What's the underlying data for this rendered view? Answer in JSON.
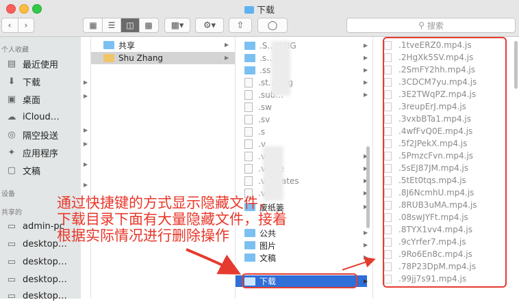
{
  "window": {
    "title": "下载"
  },
  "toolbar": {
    "search_placeholder": "搜索"
  },
  "sidebar": {
    "favorites_header": "个人收藏",
    "favorites": [
      "最近使用",
      "下载",
      "桌面",
      "iCloud…",
      "隔空投送",
      "应用程序",
      "文稿"
    ],
    "devices_header": "设备",
    "shared_header": "共享的",
    "shared": [
      "admin-pc",
      "desktop…",
      "desktop…",
      "desktop…",
      "desktop…"
    ]
  },
  "column2": {
    "items": [
      "共享",
      "Shu Zhang"
    ]
  },
  "column3": {
    "items": [
      ".S…X-NG",
      ".s…put",
      ".ss",
      ".st…Msg",
      ".sub…",
      ".sw",
      ".sv",
      ".s",
      ".v",
      ".v",
      ".v…de",
      ".v…plates",
      ".v…",
      "废纸篓",
      "公共",
      "图片",
      "文稿",
      "下载"
    ]
  },
  "column4": {
    "files": [
      ".1tveERZ0.mp4.js",
      ".2HgXk5SV.mp4.js",
      ".2SmFY2hh.mp4.js",
      ".3CDCM7yu.mp4.js",
      ".3E2TWqPZ.mp4.js",
      ".3reupErJ.mp4.js",
      ".3vxbBTa1.mp4.js",
      ".4wfFvQ0E.mp4.js",
      ".5f2JPekX.mp4.js",
      ".5PmzcFvn.mp4.js",
      ".5sEJ87JM.mp4.js",
      ".5tEt0tqs.mp4.js",
      ".8J6NcmhU.mp4.js",
      ".8RUB3uMA.mp4.js",
      ".08swJYFt.mp4.js",
      ".8TYX1vv4.mp4.js",
      ".9cYrfer7.mp4.js",
      ".9Ro6En8c.mp4.js",
      ".78P23DpM.mp4.js",
      ".99jj7s91.mp4.js"
    ]
  },
  "annotation": {
    "lines": [
      "通过快捷键的方式显示隐藏文件，",
      "下载目录下面有大量隐藏文件，接着",
      "根据实际情况进行删除操作"
    ]
  },
  "colors": {
    "highlight": "#e53b2e",
    "selection": "#2f6fd8",
    "folder": "#7cc0f2"
  }
}
